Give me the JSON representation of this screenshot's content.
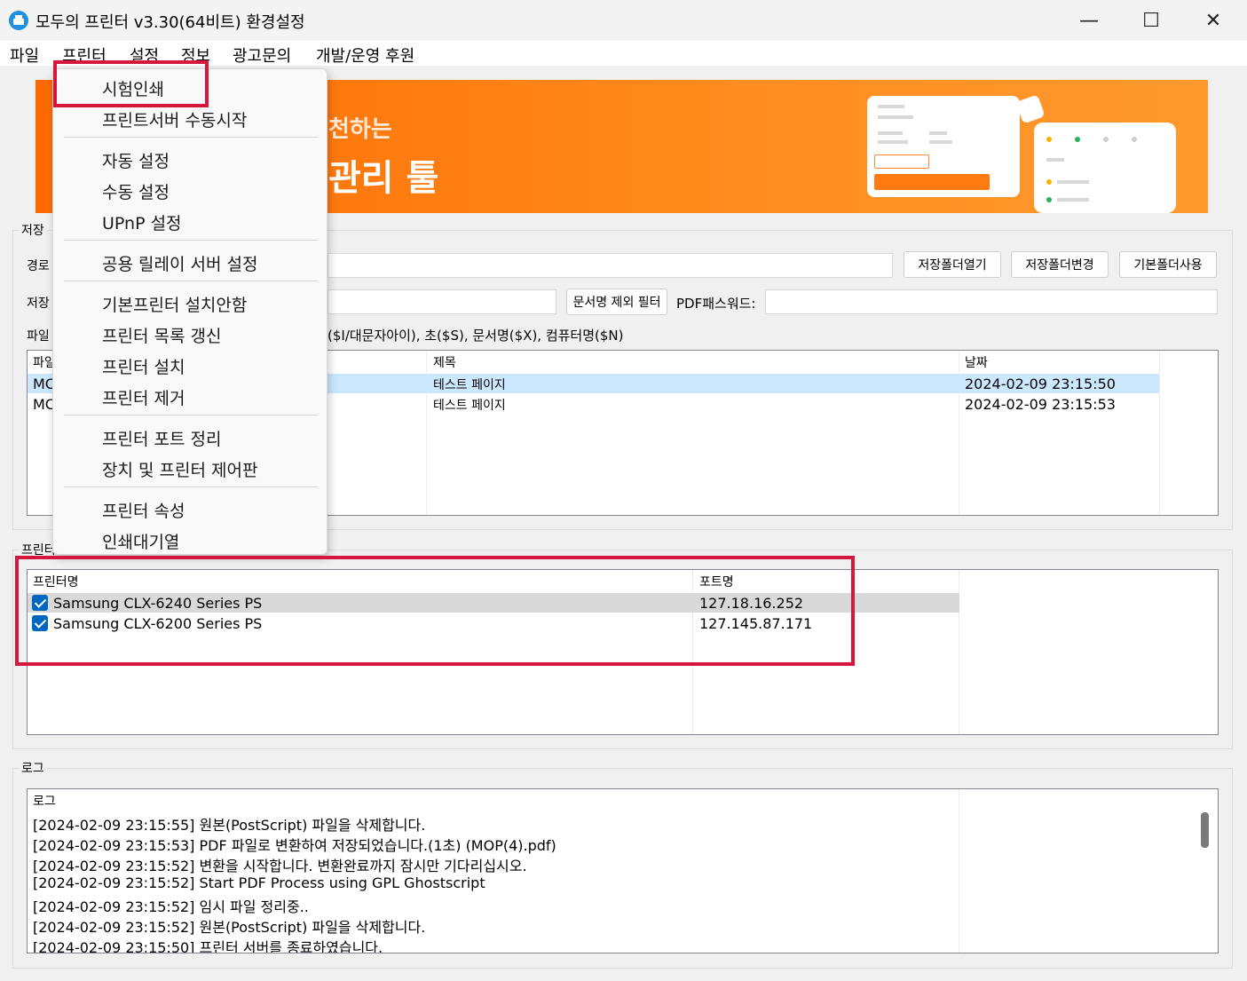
{
  "window": {
    "title": "모두의 프린터 v3.30(64비트) 환경설정",
    "app_icon": "printer-icon",
    "controls": {
      "minimize": "—",
      "maximize": "☐",
      "close": "✕"
    }
  },
  "menubar": [
    "파일",
    "프린터",
    "설정",
    "정보",
    "광고문의",
    "개발/운영 후원"
  ],
  "popup_menu": [
    "시험인쇄",
    "프린트서버 수동시작",
    "자동 설정",
    "수동 설정",
    "UPnP 설정",
    "공용 릴레이 서버 설정",
    "기본프린터 설치안함",
    "프린터 목록 갱신",
    "프린터 설치",
    "프린터 제거",
    "프린터 포트 정리",
    "장치 및 프린터 제어판",
    "프린터 속성",
    "인쇄대기열"
  ],
  "banner": {
    "line1": "천하는",
    "line2": "관리 툴"
  },
  "save_group": {
    "label": "저장",
    "path_label": "경로",
    "name_label": "저장",
    "open_folder": "저장폴더열기",
    "change_folder": "저장폴더변경",
    "default_folder": "기본폴더사용",
    "doc_filter": "문서명 제외 필터",
    "pdf_password_label": "PDF패스워드:",
    "pattern_label": "파일",
    "pattern_hint": "($I/대문자아이), 초($S), 문서명($X), 컴퓨터명($N)"
  },
  "file_list": {
    "headers": [
      "파일",
      "제목",
      "날짜"
    ],
    "rows": [
      {
        "file": "MC",
        "title": "테스트 페이지",
        "date": "2024-02-09 23:15:50"
      },
      {
        "file": "MC",
        "title": "테스트 페이지",
        "date": "2024-02-09 23:15:53"
      }
    ]
  },
  "printer_group": {
    "label": "프린터",
    "headers": [
      "프린터명",
      "포트명"
    ],
    "rows": [
      {
        "name": "Samsung CLX-6240 Series PS",
        "port": "127.18.16.252",
        "checked": true
      },
      {
        "name": "Samsung CLX-6200 Series PS",
        "port": "127.145.87.171",
        "checked": true
      }
    ]
  },
  "log_group": {
    "label": "로그",
    "header": "로그",
    "lines": [
      "[2024-02-09 23:15:55] 원본(PostScript) 파일을 삭제합니다.",
      "[2024-02-09 23:15:53] PDF 파일로 변환하여 저장되었습니다.(1초) (MOP(4).pdf)",
      "[2024-02-09 23:15:52] 변환을 시작합니다. 변환완료까지 잠시만 기다리십시오.",
      "[2024-02-09 23:15:52] Start PDF Process using GPL Ghostscript",
      "[2024-02-09 23:15:52] 임시 파일 정리중..",
      "[2024-02-09 23:15:52] 원본(PostScript) 파일을 삭제합니다.",
      "[2024-02-09 23:15:50] 프린터 서버를 종료하였습니다."
    ]
  },
  "colors": {
    "highlight": "#d6173c",
    "selection": "#cce8ff",
    "banner": "#ff7a10",
    "check": "#0067c0"
  }
}
